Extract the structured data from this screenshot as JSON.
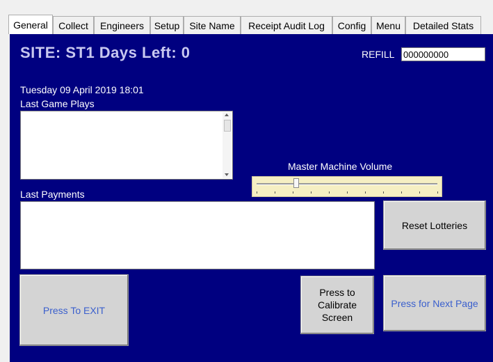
{
  "tabs": [
    {
      "label": "General",
      "active": true
    },
    {
      "label": "Collect"
    },
    {
      "label": "Engineers"
    },
    {
      "label": "Setup"
    },
    {
      "label": "Site Name"
    },
    {
      "label": "Receipt Audit Log"
    },
    {
      "label": "Config"
    },
    {
      "label": "Menu"
    },
    {
      "label": "Detailed Stats"
    }
  ],
  "site_title": "SITE: ST1 Days Left: 0",
  "refill": {
    "label": "REFILL",
    "value": "000000000"
  },
  "datetime": "Tuesday 09 April 2019 18:01",
  "last_game_plays": {
    "label": "Last Game Plays",
    "items": []
  },
  "master_volume": {
    "label": "Master Machine Volume",
    "level": 0.22,
    "ticks": 11
  },
  "last_payments": {
    "label": "Last  Payments",
    "items": []
  },
  "buttons": {
    "reset_lotteries": "Reset Lotteries",
    "exit": "Press To EXIT",
    "calibrate": "Press to\nCalibrate\nScreen",
    "next_page": "Press for Next Page"
  },
  "colors": {
    "panel": "#000080",
    "title": "#c8c8f0",
    "button_link": "#3a5fcd",
    "slider_bg": "#f5efc3"
  }
}
